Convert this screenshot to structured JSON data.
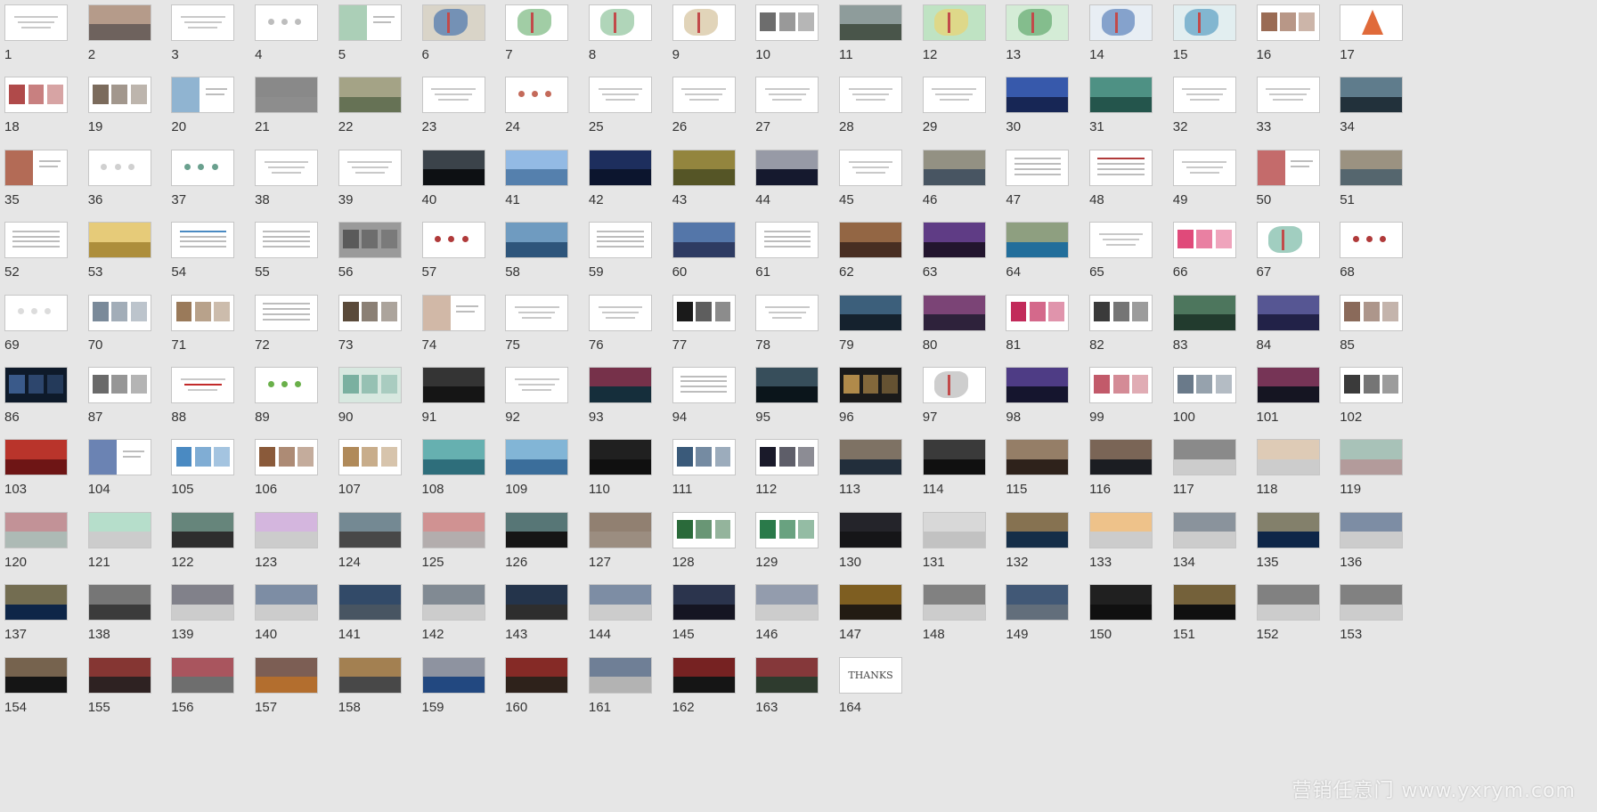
{
  "app": {
    "view": "slide-sorter"
  },
  "slides": [
    {
      "n": "1",
      "kind": "title",
      "bg": "#ffffff"
    },
    {
      "n": "2",
      "kind": "photo",
      "bg": "#8a7a74",
      "c2": "#d9b79d"
    },
    {
      "n": "3",
      "kind": "text",
      "bg": "#ffffff"
    },
    {
      "n": "4",
      "kind": "dots",
      "bg": "#ffffff",
      "c2": "#bdbdbd"
    },
    {
      "n": "5",
      "kind": "split",
      "bg": "#ffffff",
      "c2": "#8fbf9f"
    },
    {
      "n": "6",
      "kind": "map",
      "bg": "#d9d4c8",
      "c2": "#5a7fb0"
    },
    {
      "n": "7",
      "kind": "map",
      "bg": "#ffffff",
      "c2": "#8ac18e"
    },
    {
      "n": "8",
      "kind": "map",
      "bg": "#ffffff",
      "c2": "#9ccaa7"
    },
    {
      "n": "9",
      "kind": "map",
      "bg": "#ffffff",
      "c2": "#d9c9a8"
    },
    {
      "n": "10",
      "kind": "collage",
      "bg": "#ffffff",
      "c2": "#6d6d6d"
    },
    {
      "n": "11",
      "kind": "photo",
      "bg": "#5b6a5c",
      "c2": "#b8c5cf"
    },
    {
      "n": "12",
      "kind": "map",
      "bg": "#bfe3c3",
      "c2": "#e6d47a"
    },
    {
      "n": "13",
      "kind": "map",
      "bg": "#d4ecd6",
      "c2": "#6fb27a"
    },
    {
      "n": "14",
      "kind": "map",
      "bg": "#e8eef4",
      "c2": "#6b8fc2"
    },
    {
      "n": "15",
      "kind": "map",
      "bg": "#e2eef0",
      "c2": "#6aa7c8"
    },
    {
      "n": "16",
      "kind": "collage",
      "bg": "#ffffff",
      "c2": "#9a6b54"
    },
    {
      "n": "17",
      "kind": "chart",
      "bg": "#ffffff",
      "c2": "#e06a3a"
    },
    {
      "n": "18",
      "kind": "collage",
      "bg": "#ffffff",
      "c2": "#b04a4a"
    },
    {
      "n": "19",
      "kind": "collage",
      "bg": "#ffffff",
      "c2": "#7b6b5c"
    },
    {
      "n": "20",
      "kind": "split",
      "bg": "#ffffff",
      "c2": "#6b9bc2"
    },
    {
      "n": "21",
      "kind": "photo",
      "bg": "#b0b0b0",
      "c2": "#6a6a6a"
    },
    {
      "n": "22",
      "kind": "photo",
      "bg": "#7f8e6a",
      "c2": "#c2b49c"
    },
    {
      "n": "23",
      "kind": "text",
      "bg": "#ffffff"
    },
    {
      "n": "24",
      "kind": "dots",
      "bg": "#ffffff",
      "c2": "#c46a5a"
    },
    {
      "n": "25",
      "kind": "text",
      "bg": "#ffffff"
    },
    {
      "n": "26",
      "kind": "text",
      "bg": "#ffffff"
    },
    {
      "n": "27",
      "kind": "text",
      "bg": "#ffffff"
    },
    {
      "n": "28",
      "kind": "text",
      "bg": "#ffffff"
    },
    {
      "n": "29",
      "kind": "text",
      "bg": "#ffffff"
    },
    {
      "n": "30",
      "kind": "photo",
      "bg": "#1d2f6a",
      "c2": "#4c7be0"
    },
    {
      "n": "31",
      "kind": "photo",
      "bg": "#2d6a5f",
      "c2": "#6ab0a3"
    },
    {
      "n": "32",
      "kind": "text",
      "bg": "#ffffff"
    },
    {
      "n": "33",
      "kind": "text",
      "bg": "#ffffff"
    },
    {
      "n": "34",
      "kind": "photo",
      "bg": "#2b3d4a",
      "c2": "#8ab0c2"
    },
    {
      "n": "35",
      "kind": "split",
      "bg": "#ffffff",
      "c2": "#9a3a1e"
    },
    {
      "n": "36",
      "kind": "dots",
      "bg": "#ffffff",
      "c2": "#d0d0d0"
    },
    {
      "n": "37",
      "kind": "dots",
      "bg": "#ffffff",
      "c2": "#6aa08e"
    },
    {
      "n": "38",
      "kind": "text",
      "bg": "#ffffff"
    },
    {
      "n": "39",
      "kind": "text",
      "bg": "#ffffff"
    },
    {
      "n": "40",
      "kind": "photo",
      "bg": "#101418",
      "c2": "#5e6a74"
    },
    {
      "n": "41",
      "kind": "photo",
      "bg": "#6aa0d8",
      "c2": "#b5d0ee"
    },
    {
      "n": "42",
      "kind": "photo",
      "bg": "#0f1a3a",
      "c2": "#2a3f7a"
    },
    {
      "n": "43",
      "kind": "photo",
      "bg": "#6a6a30",
      "c2": "#b49a4a"
    },
    {
      "n": "44",
      "kind": "photo",
      "bg": "#1a1f3a",
      "c2": "#ffffff"
    },
    {
      "n": "45",
      "kind": "text",
      "bg": "#ffffff"
    },
    {
      "n": "46",
      "kind": "photo",
      "bg": "#5a6a7a",
      "c2": "#c2b08a"
    },
    {
      "n": "47",
      "kind": "table",
      "bg": "#ffffff"
    },
    {
      "n": "48",
      "kind": "table",
      "bg": "#ffffff",
      "c2": "#b03a3a"
    },
    {
      "n": "49",
      "kind": "text",
      "bg": "#ffffff"
    },
    {
      "n": "50",
      "kind": "split",
      "bg": "#ffffff",
      "c2": "#b03a3a"
    },
    {
      "n": "51",
      "kind": "photo",
      "bg": "#6a7f8a",
      "c2": "#c2a27a"
    },
    {
      "n": "52",
      "kind": "table",
      "bg": "#ffffff"
    },
    {
      "n": "53",
      "kind": "photo",
      "bg": "#d8b24a",
      "c2": "#f2e0a0"
    },
    {
      "n": "54",
      "kind": "table",
      "bg": "#ffffff",
      "c2": "#4a8ac2"
    },
    {
      "n": "55",
      "kind": "table",
      "bg": "#ffffff"
    },
    {
      "n": "56",
      "kind": "collage",
      "bg": "#9a9a9a",
      "c2": "#5a5a5a"
    },
    {
      "n": "57",
      "kind": "dots",
      "bg": "#ffffff",
      "c2": "#b03a3a"
    },
    {
      "n": "58",
      "kind": "photo",
      "bg": "#3a6a9a",
      "c2": "#9ac2e0"
    },
    {
      "n": "59",
      "kind": "table",
      "bg": "#ffffff"
    },
    {
      "n": "60",
      "kind": "photo",
      "bg": "#3a4a7a",
      "c2": "#6a9ad0"
    },
    {
      "n": "61",
      "kind": "table",
      "bg": "#ffffff"
    },
    {
      "n": "62",
      "kind": "photo",
      "bg": "#5a3a2a",
      "c2": "#c28a5a"
    },
    {
      "n": "63",
      "kind": "photo",
      "bg": "#2a1a3a",
      "c2": "#8a5ac2"
    },
    {
      "n": "64",
      "kind": "photo",
      "bg": "#2a8ac2",
      "c2": "#e0b04a"
    },
    {
      "n": "65",
      "kind": "text",
      "bg": "#ffffff"
    },
    {
      "n": "66",
      "kind": "collage",
      "bg": "#ffffff",
      "c2": "#e04a7a"
    },
    {
      "n": "67",
      "kind": "map",
      "bg": "#ffffff",
      "c2": "#8ac2b0"
    },
    {
      "n": "68",
      "kind": "dots",
      "bg": "#ffffff",
      "c2": "#b03a3a"
    },
    {
      "n": "69",
      "kind": "dots",
      "bg": "#ffffff",
      "c2": "#dcdcdc"
    },
    {
      "n": "70",
      "kind": "collage",
      "bg": "#ffffff",
      "c2": "#7a8a9a"
    },
    {
      "n": "71",
      "kind": "collage",
      "bg": "#ffffff",
      "c2": "#9a7a5a"
    },
    {
      "n": "72",
      "kind": "table",
      "bg": "#ffffff"
    },
    {
      "n": "73",
      "kind": "collage",
      "bg": "#ffffff",
      "c2": "#5a4a3a"
    },
    {
      "n": "74",
      "kind": "split",
      "bg": "#ffffff",
      "c2": "#c2a08a"
    },
    {
      "n": "75",
      "kind": "text",
      "bg": "#ffffff"
    },
    {
      "n": "76",
      "kind": "text",
      "bg": "#ffffff"
    },
    {
      "n": "77",
      "kind": "collage",
      "bg": "#ffffff",
      "c2": "#1a1a1a"
    },
    {
      "n": "78",
      "kind": "text",
      "bg": "#ffffff"
    },
    {
      "n": "79",
      "kind": "photo",
      "bg": "#1a2a3a",
      "c2": "#5a8ab0"
    },
    {
      "n": "80",
      "kind": "photo",
      "bg": "#3a2a4a",
      "c2": "#b05a9a"
    },
    {
      "n": "81",
      "kind": "collage",
      "bg": "#ffffff",
      "c2": "#c22a5a"
    },
    {
      "n": "82",
      "kind": "collage",
      "bg": "#ffffff",
      "c2": "#3a3a3a"
    },
    {
      "n": "83",
      "kind": "photo",
      "bg": "#2a4a3a",
      "c2": "#6a9a7a"
    },
    {
      "n": "84",
      "kind": "photo",
      "bg": "#2a2a5a",
      "c2": "#7a7ac2"
    },
    {
      "n": "85",
      "kind": "collage",
      "bg": "#ffffff",
      "c2": "#8a6a5a"
    },
    {
      "n": "86",
      "kind": "collage",
      "bg": "#0e1a2a",
      "c2": "#3a5a8a"
    },
    {
      "n": "87",
      "kind": "collage",
      "bg": "#ffffff",
      "c2": "#6a6a6a"
    },
    {
      "n": "88",
      "kind": "text",
      "bg": "#ffffff",
      "c2": "#c22a2a"
    },
    {
      "n": "89",
      "kind": "dots",
      "bg": "#ffffff",
      "c2": "#6ab04a"
    },
    {
      "n": "90",
      "kind": "collage",
      "bg": "#d8e8e0",
      "c2": "#7ab0a0"
    },
    {
      "n": "91",
      "kind": "photo",
      "bg": "#1a1a1a",
      "c2": "#4a4a4a"
    },
    {
      "n": "92",
      "kind": "text",
      "bg": "#ffffff"
    },
    {
      "n": "93",
      "kind": "photo",
      "bg": "#1a3a4a",
      "c2": "#c22a4a"
    },
    {
      "n": "94",
      "kind": "table",
      "bg": "#ffffff"
    },
    {
      "n": "95",
      "kind": "photo",
      "bg": "#0e1a22",
      "c2": "#5a7a8a"
    },
    {
      "n": "96",
      "kind": "collage",
      "bg": "#1a1a1a",
      "c2": "#b08a4a"
    },
    {
      "n": "97",
      "kind": "map",
      "bg": "#ffffff",
      "c2": "#c2c2c2"
    },
    {
      "n": "98",
      "kind": "photo",
      "bg": "#1a1a3a",
      "c2": "#7a5ac2"
    },
    {
      "n": "99",
      "kind": "collage",
      "bg": "#ffffff",
      "c2": "#c25a6a"
    },
    {
      "n": "100",
      "kind": "collage",
      "bg": "#ffffff",
      "c2": "#6a7a8a"
    },
    {
      "n": "101",
      "kind": "photo",
      "bg": "#1a1a2a",
      "c2": "#c24a7a"
    },
    {
      "n": "102",
      "kind": "collage",
      "bg": "#ffffff",
      "c2": "#3a3a3a"
    },
    {
      "n": "103",
      "kind": "photo",
      "bg": "#8a1a1a",
      "c2": "#e04a3a"
    },
    {
      "n": "104",
      "kind": "split",
      "bg": "#ffffff",
      "c2": "#3a5a9a"
    },
    {
      "n": "105",
      "kind": "collage",
      "bg": "#ffffff",
      "c2": "#4a8ac2"
    },
    {
      "n": "106",
      "kind": "collage",
      "bg": "#ffffff",
      "c2": "#8a5a3a"
    },
    {
      "n": "107",
      "kind": "collage",
      "bg": "#ffffff",
      "c2": "#b08a5a"
    },
    {
      "n": "108",
      "kind": "photo",
      "bg": "#3a8a9a",
      "c2": "#8ad0c2"
    },
    {
      "n": "109",
      "kind": "photo",
      "bg": "#4a8ac2",
      "c2": "#b0d8e8"
    },
    {
      "n": "110",
      "kind": "photo",
      "bg": "#141414",
      "c2": "#2a2a2a"
    },
    {
      "n": "111",
      "kind": "collage",
      "bg": "#ffffff",
      "c2": "#3a5a7a"
    },
    {
      "n": "112",
      "kind": "collage",
      "bg": "#ffffff",
      "c2": "#1a1a2a"
    },
    {
      "n": "113",
      "kind": "photo",
      "bg": "#2a3a4a",
      "c2": "#c2a07a"
    },
    {
      "n": "114",
      "kind": "photo",
      "bg": "#141414",
      "c2": "#5a5a5a"
    },
    {
      "n": "115",
      "kind": "photo",
      "bg": "#3a2a22",
      "c2": "#e0c2a0"
    },
    {
      "n": "116",
      "kind": "photo",
      "bg": "#22242a",
      "c2": "#c29a7a"
    },
    {
      "n": "117",
      "kind": "photo",
      "bg": "#ffffff",
      "c2": "#2a2a2a"
    },
    {
      "n": "118",
      "kind": "photo",
      "bg": "#ffffff",
      "c2": "#c2a07a"
    },
    {
      "n": "119",
      "kind": "photo",
      "bg": "#e0c2c2",
      "c2": "#7ac2b0"
    },
    {
      "n": "120",
      "kind": "photo",
      "bg": "#d8e8e2",
      "c2": "#b04a5a"
    },
    {
      "n": "121",
      "kind": "photo",
      "bg": "#ffffff",
      "c2": "#7ac2a0"
    },
    {
      "n": "122",
      "kind": "photo",
      "bg": "#3a3a3a",
      "c2": "#8ac2b0"
    },
    {
      "n": "123",
      "kind": "photo",
      "bg": "#ffffff",
      "c2": "#b07ac2"
    },
    {
      "n": "124",
      "kind": "photo",
      "bg": "#5a5a5a",
      "c2": "#8ab0c2"
    },
    {
      "n": "125",
      "kind": "photo",
      "bg": "#e0d8d8",
      "c2": "#c25a5a"
    },
    {
      "n": "126",
      "kind": "photo",
      "bg": "#1a1a1a",
      "c2": "#8ac2c2"
    },
    {
      "n": "127",
      "kind": "photo",
      "bg": "#c2b0a0",
      "c2": "#6a5a4a"
    },
    {
      "n": "128",
      "kind": "collage",
      "bg": "#ffffff",
      "c2": "#2a6a3a"
    },
    {
      "n": "129",
      "kind": "collage",
      "bg": "#ffffff",
      "c2": "#2a7a4a"
    },
    {
      "n": "130",
      "kind": "photo",
      "bg": "#1a1a1e",
      "c2": "#2e2e34"
    },
    {
      "n": "131",
      "kind": "photo",
      "bg": "#f2f2f2",
      "c2": "#c2c2c2"
    },
    {
      "n": "132",
      "kind": "photo",
      "bg": "#1a3a5a",
      "c2": "#e0a04a"
    },
    {
      "n": "133",
      "kind": "photo",
      "bg": "#ffffff",
      "c2": "#e0902a"
    },
    {
      "n": "134",
      "kind": "photo",
      "bg": "#ffffff",
      "c2": "#2a3a4a"
    },
    {
      "n": "135",
      "kind": "photo",
      "bg": "#12305a",
      "c2": "#e0c27a"
    },
    {
      "n": "136",
      "kind": "photo",
      "bg": "#ffffff",
      "c2": "#12305a"
    },
    {
      "n": "137",
      "kind": "photo",
      "bg": "#12305a",
      "c2": "#c2a04a"
    },
    {
      "n": "138",
      "kind": "photo",
      "bg": "#4a4a4a",
      "c2": "#9a9a9a"
    },
    {
      "n": "139",
      "kind": "photo",
      "bg": "#ffffff",
      "c2": "#1a1a2a"
    },
    {
      "n": "140",
      "kind": "photo",
      "bg": "#ffffff",
      "c2": "#12305a"
    },
    {
      "n": "141",
      "kind": "photo",
      "bg": "#5a6a7a",
      "c2": "#12305a"
    },
    {
      "n": "142",
      "kind": "photo",
      "bg": "#ffffff",
      "c2": "#1a2a3a"
    },
    {
      "n": "143",
      "kind": "photo",
      "bg": "#3a3a3a",
      "c2": "#12305a"
    },
    {
      "n": "144",
      "kind": "photo",
      "bg": "#ffffff",
      "c2": "#12305a"
    },
    {
      "n": "145",
      "kind": "photo",
      "bg": "#1a1a2a",
      "c2": "#3a4a6a"
    },
    {
      "n": "146",
      "kind": "photo",
      "bg": "#ffffff",
      "c2": "#3a4a6a"
    },
    {
      "n": "147",
      "kind": "photo",
      "bg": "#2a2218",
      "c2": "#c2902a"
    },
    {
      "n": "148",
      "kind": "photo",
      "bg": "#ffffff",
      "c2": "#1a1a1a"
    },
    {
      "n": "149",
      "kind": "photo",
      "bg": "#7a8a9a",
      "c2": "#12305a"
    },
    {
      "n": "150",
      "kind": "photo",
      "bg": "#141414",
      "c2": "#2a2a2a"
    },
    {
      "n": "151",
      "kind": "photo",
      "bg": "#141414",
      "c2": "#c2a05a"
    },
    {
      "n": "152",
      "kind": "photo",
      "bg": "#ffffff",
      "c2": "#1a1a1a"
    },
    {
      "n": "153",
      "kind": "photo",
      "bg": "#ffffff",
      "c2": "#1a1a1a"
    },
    {
      "n": "154",
      "kind": "photo",
      "bg": "#1a1a1a",
      "c2": "#c2a07a"
    },
    {
      "n": "155",
      "kind": "photo",
      "bg": "#3a2a2a",
      "c2": "#c2403a"
    },
    {
      "n": "156",
      "kind": "photo",
      "bg": "#8a8a8a",
      "c2": "#c22a3a"
    },
    {
      "n": "157",
      "kind": "photo",
      "bg": "#e08a3a",
      "c2": "#2a3a6a"
    },
    {
      "n": "158",
      "kind": "photo",
      "bg": "#5a5a5a",
      "c2": "#e0a04a"
    },
    {
      "n": "159",
      "kind": "photo",
      "bg": "#2a5aa0",
      "c2": "#e0c2a0"
    },
    {
      "n": "160",
      "kind": "photo",
      "bg": "#3a2a22",
      "c2": "#c22a2a"
    },
    {
      "n": "161",
      "kind": "photo",
      "bg": "#e0e0e0",
      "c2": "#12305a"
    },
    {
      "n": "162",
      "kind": "photo",
      "bg": "#1a1a1a",
      "c2": "#c22a2a"
    },
    {
      "n": "163",
      "kind": "photo",
      "bg": "#3a4a3a",
      "c2": "#c22a3a"
    },
    {
      "n": "164",
      "kind": "thanks",
      "bg": "#ffffff",
      "text": "THANKS"
    }
  ],
  "watermark": "营销任意门 www.yxrym.com"
}
